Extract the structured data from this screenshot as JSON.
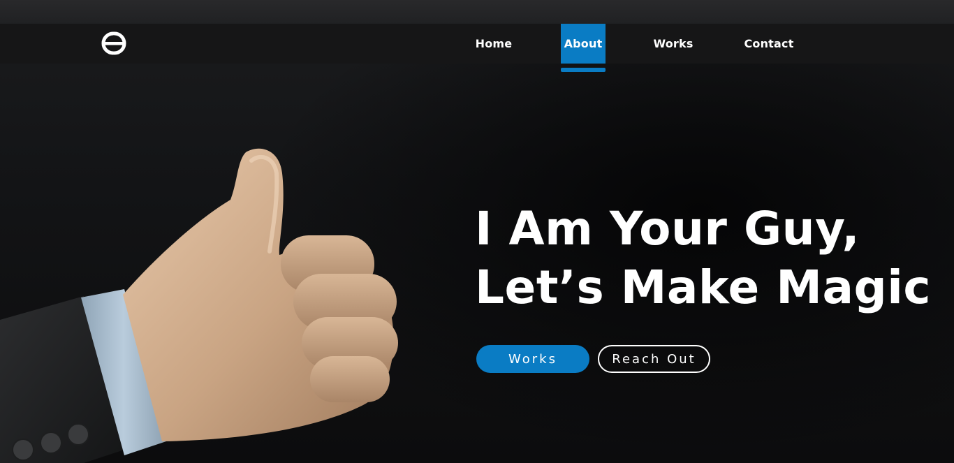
{
  "nav": {
    "items": [
      {
        "label": "Home",
        "active": false
      },
      {
        "label": "About",
        "active": true
      },
      {
        "label": "Works",
        "active": false
      },
      {
        "label": "Contact",
        "active": false
      }
    ]
  },
  "logo": {
    "icon": "logo-icon"
  },
  "hero": {
    "headline_line1": "I Am Your Guy,",
    "headline_line2": "Let’s Make Magic",
    "image_icon": "thumbs-up-hand-illustration",
    "buttons": {
      "works_label": "Works",
      "reach_label": "Reach Out"
    }
  },
  "colors": {
    "accent": "#0a7cc4",
    "background": "#111214",
    "text": "#ffffff"
  }
}
